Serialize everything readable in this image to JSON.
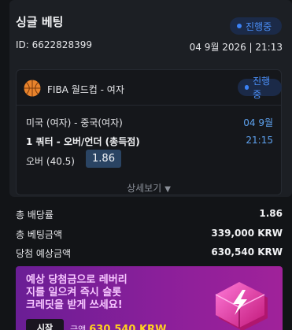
{
  "header": {
    "title": "싱글 베팅",
    "status": "진행중",
    "id_text": "ID: 6622828399",
    "datetime": "04 9월 2026 | 21:13"
  },
  "bet": {
    "league": "FIBA 월드컵 - 여자",
    "status": "진행중",
    "match": "미국 (여자) - 중국(여자)",
    "match_date": "04 9월",
    "market": "1 쿼터 - 오버/언더 (총득점)",
    "market_time": "21:15",
    "selection": "오버 (40.5)",
    "odds": "1.86",
    "detail_label": "상세보기"
  },
  "summary": [
    {
      "label": "총 배당률",
      "value": "1.86"
    },
    {
      "label": "총 베팅금액",
      "value": "339,000 KRW"
    },
    {
      "label": "당첨 예상금액",
      "value": "630,540 KRW"
    }
  ],
  "promo": {
    "line1": "예상 당첨금으로 레버리",
    "line2": "지를 일으켜 즉시 슬롯",
    "line3": "크레딧을 받게 쓰세요!",
    "button": "시작",
    "amount_prefix": "금액",
    "amount": "630,540 KRW"
  },
  "colors": {
    "accent_blue": "#3b82f6",
    "odds_bg": "#2a4463",
    "banner": "#8b1f9a",
    "amount_yellow": "#ffd21f"
  }
}
